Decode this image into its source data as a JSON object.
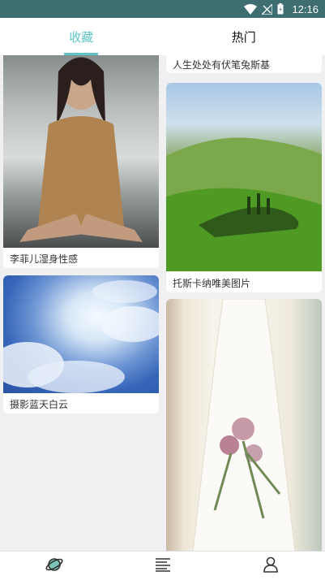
{
  "status_bar": {
    "time": "12:16"
  },
  "tabs": [
    {
      "label": "收藏",
      "active": true
    },
    {
      "label": "热门",
      "active": false
    }
  ],
  "cards_left": [
    {
      "caption": "李菲儿湿身性感"
    },
    {
      "caption": "摄影蓝天白云"
    }
  ],
  "cards_right": [
    {
      "caption": "人生处处有伏笔兔斯基"
    },
    {
      "caption": "托斯卡纳唯美图片"
    },
    {
      "caption": ""
    }
  ],
  "bottom_nav": [
    {
      "icon": "planet-icon"
    },
    {
      "icon": "list-icon"
    },
    {
      "icon": "user-icon"
    }
  ],
  "colors": {
    "status_bar": "#3e6e72",
    "accent": "#5fc4c7"
  }
}
